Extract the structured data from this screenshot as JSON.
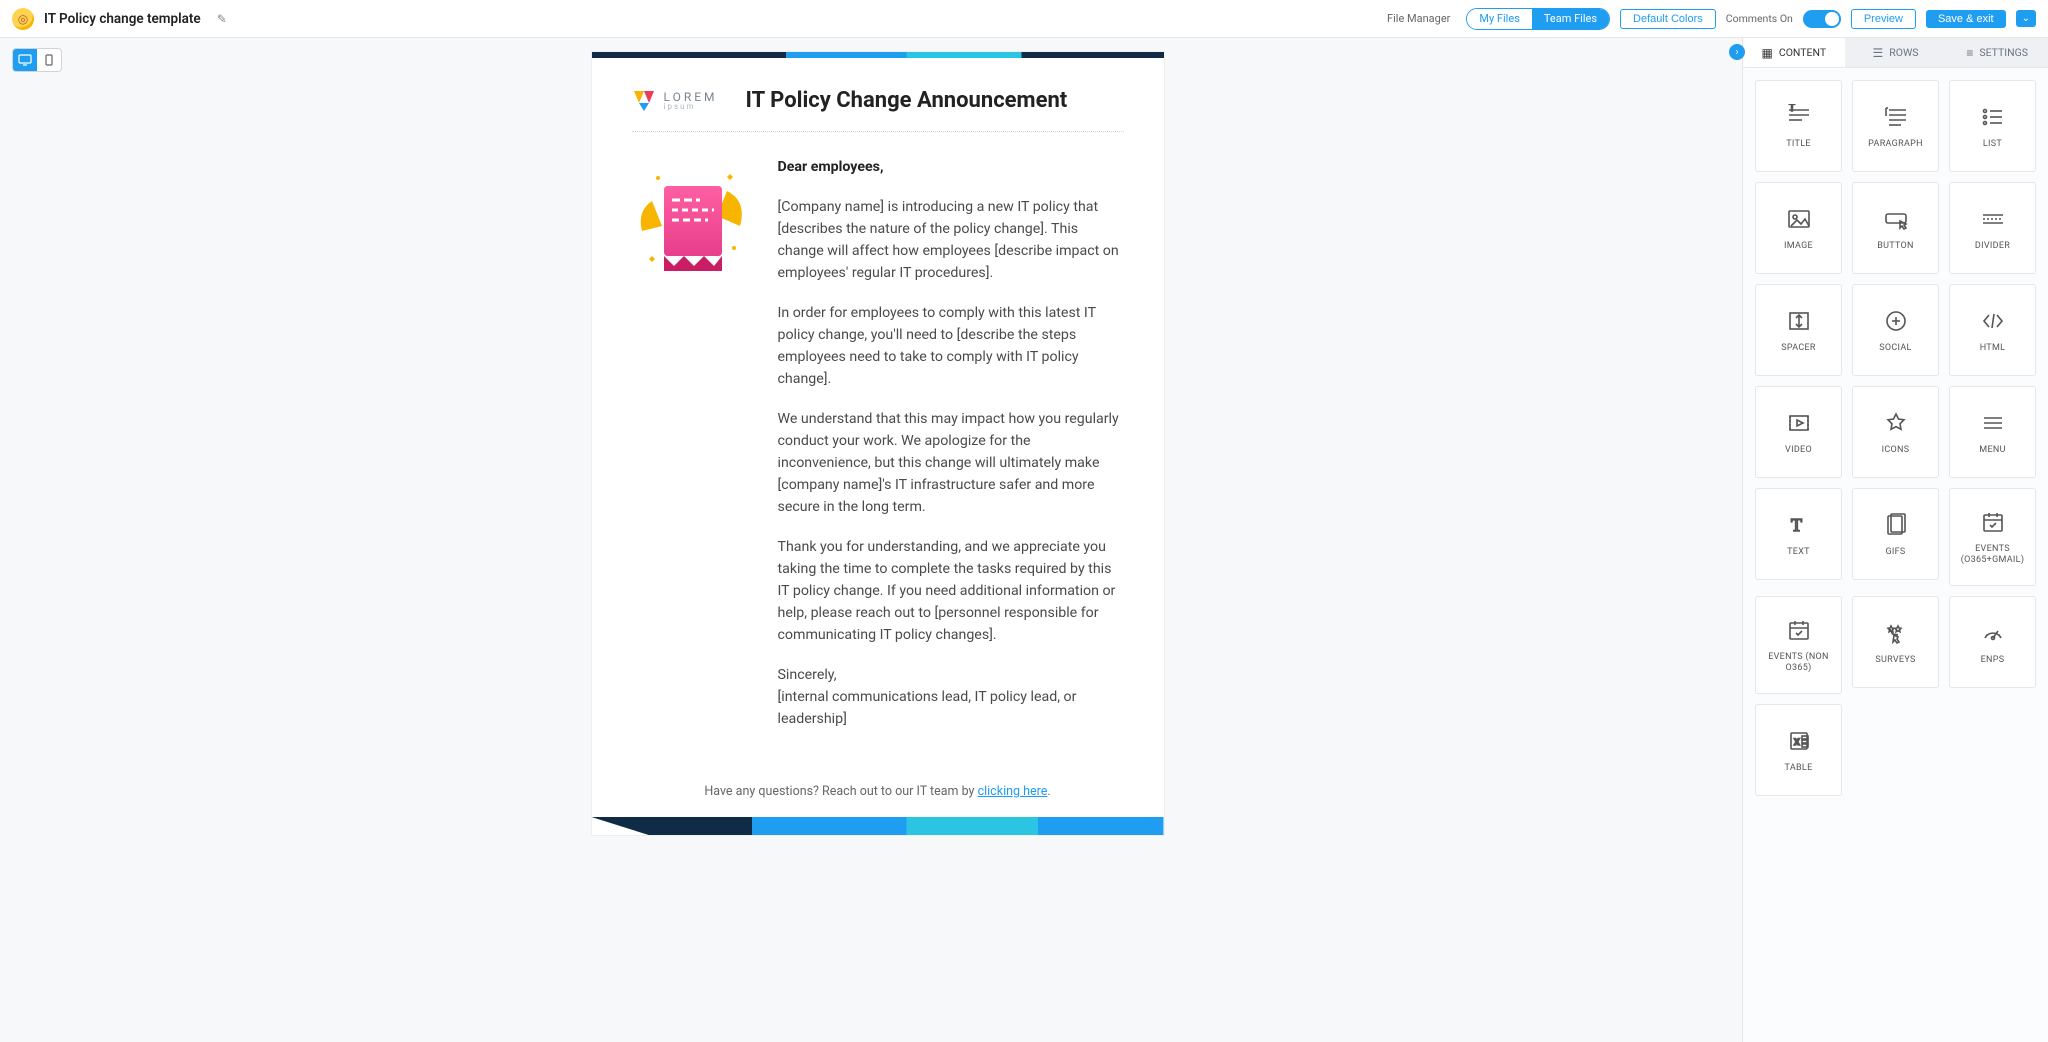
{
  "header": {
    "doc_title": "IT Policy change template",
    "file_manager_label": "File Manager",
    "files_toggle": {
      "inactive": "My Files",
      "active": "Team Files"
    },
    "default_colors": "Default Colors",
    "comments_label": "Comments On",
    "preview": "Preview",
    "save_exit": "Save & exit"
  },
  "email": {
    "brand_name": "LOREM",
    "brand_sub": "ipsum",
    "title": "IT Policy Change Announcement",
    "greeting": "Dear employees,",
    "p1": "[Company name] is introducing a new IT policy that [describes the nature of the policy change]. This change will affect how employees [describe impact on employees' regular IT procedures].",
    "p2": "In order for employees to comply with this latest IT policy change, you'll need to [describe the steps employees need to take to comply with IT policy change].",
    "p3": "We understand that this may impact how you regularly conduct your work. We apologize for the inconvenience, but this change will ultimately make [company name]'s IT infrastructure safer and more secure in the long term.",
    "p4": "Thank you for understanding, and we appreciate you taking the time to complete the tasks required by this IT policy change. If you need additional information or help, please reach out to [personnel responsible for communicating IT policy changes].",
    "signoff": "Sincerely,",
    "signature": "[internal communications lead, IT policy lead, or leadership]",
    "footer_prefix": "Have any questions? Reach out to our IT team by ",
    "footer_link": "clicking here"
  },
  "right_panel": {
    "tabs": {
      "content": "CONTENT",
      "rows": "ROWS",
      "settings": "SETTINGS"
    },
    "tiles": [
      {
        "id": "title",
        "label": "TITLE"
      },
      {
        "id": "paragraph",
        "label": "PARAGRAPH"
      },
      {
        "id": "list",
        "label": "LIST"
      },
      {
        "id": "image",
        "label": "IMAGE"
      },
      {
        "id": "button",
        "label": "BUTTON"
      },
      {
        "id": "divider",
        "label": "DIVIDER"
      },
      {
        "id": "spacer",
        "label": "SPACER"
      },
      {
        "id": "social",
        "label": "SOCIAL"
      },
      {
        "id": "html",
        "label": "HTML"
      },
      {
        "id": "video",
        "label": "VIDEO"
      },
      {
        "id": "icons",
        "label": "ICONS"
      },
      {
        "id": "menu",
        "label": "MENU"
      },
      {
        "id": "text",
        "label": "TEXT"
      },
      {
        "id": "gifs",
        "label": "GIFS"
      },
      {
        "id": "events-o365",
        "label": "EVENTS (O365+GMAIL)"
      },
      {
        "id": "events-non-o365",
        "label": "EVENTS (NON O365)"
      },
      {
        "id": "surveys",
        "label": "SURVEYS"
      },
      {
        "id": "enps",
        "label": "ENPS"
      },
      {
        "id": "table",
        "label": "TABLE"
      }
    ]
  }
}
